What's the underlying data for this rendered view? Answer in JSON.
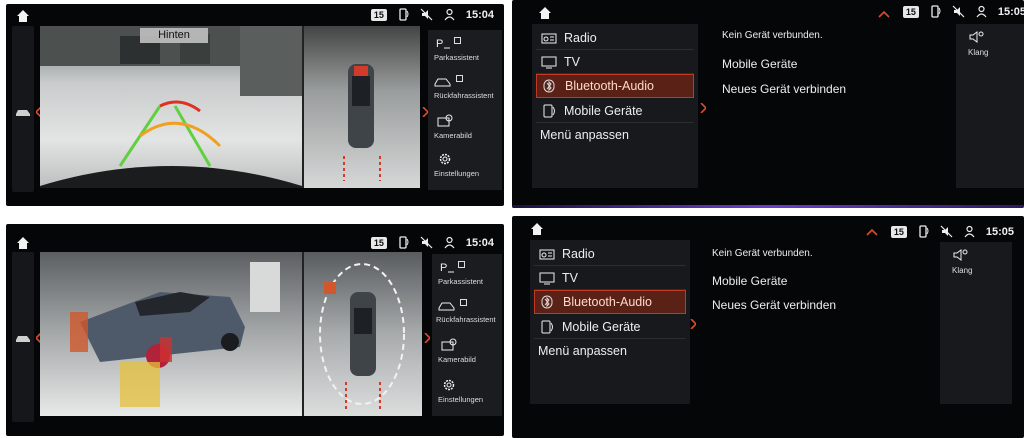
{
  "status": {
    "badge": "15",
    "time_tl": "15:04",
    "time_bl": "15:04",
    "time_tr": "15:05",
    "time_br": "15:05"
  },
  "camera": {
    "view_label": "Hinten"
  },
  "assist_menu": {
    "items": [
      {
        "label": "Parkassistent",
        "icon": "park-p-icon"
      },
      {
        "label": "Rückfahrassistent",
        "icon": "reverse-car-icon"
      },
      {
        "label": "Kamerabild",
        "icon": "camera-icon"
      },
      {
        "label": "Einstellungen",
        "icon": "gear-icon"
      }
    ]
  },
  "media_menu": {
    "items": [
      {
        "label": "Radio",
        "icon": "radio-icon"
      },
      {
        "label": "TV",
        "icon": "tv-icon"
      },
      {
        "label": "Bluetooth-Audio",
        "icon": "bluetooth-icon",
        "active": true
      },
      {
        "label": "Mobile Geräte",
        "icon": "phone-icon"
      },
      {
        "label": "Menü anpassen"
      }
    ]
  },
  "bluetooth_content": {
    "message": "Kein Gerät verbunden.",
    "option1": "Mobile Geräte",
    "option2": "Neues Gerät verbinden"
  },
  "klang": {
    "label": "Klang",
    "icon": "speaker-icon"
  },
  "colors": {
    "accent": "#c23a22",
    "active_bg": "#5a2116",
    "bg": "#050608"
  }
}
